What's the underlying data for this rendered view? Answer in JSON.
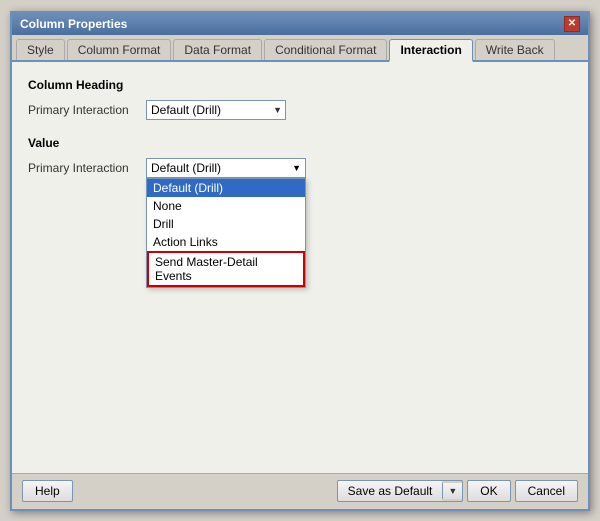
{
  "dialog": {
    "title": "Column Properties",
    "close_label": "✕"
  },
  "tabs": [
    {
      "label": "Style",
      "active": false
    },
    {
      "label": "Column Format",
      "active": false
    },
    {
      "label": "Data Format",
      "active": false
    },
    {
      "label": "Conditional Format",
      "active": false
    },
    {
      "label": "Interaction",
      "active": true
    },
    {
      "label": "Write Back",
      "active": false
    }
  ],
  "column_heading": {
    "section_label": "Column Heading",
    "field_label": "Primary Interaction",
    "select_value": "Default (Drill)"
  },
  "value_section": {
    "section_label": "Value",
    "field_label": "Primary Interaction",
    "select_value": "Default (Drill)",
    "dropdown_items": [
      {
        "label": "Default (Drill)",
        "selected": true,
        "highlighted": false
      },
      {
        "label": "None",
        "selected": false,
        "highlighted": false
      },
      {
        "label": "Drill",
        "selected": false,
        "highlighted": false
      },
      {
        "label": "Action Links",
        "selected": false,
        "highlighted": false
      },
      {
        "label": "Send Master-Detail Events",
        "selected": false,
        "highlighted": true
      }
    ]
  },
  "footer": {
    "help_label": "Help",
    "save_default_label": "Save as Default",
    "ok_label": "OK",
    "cancel_label": "Cancel"
  }
}
